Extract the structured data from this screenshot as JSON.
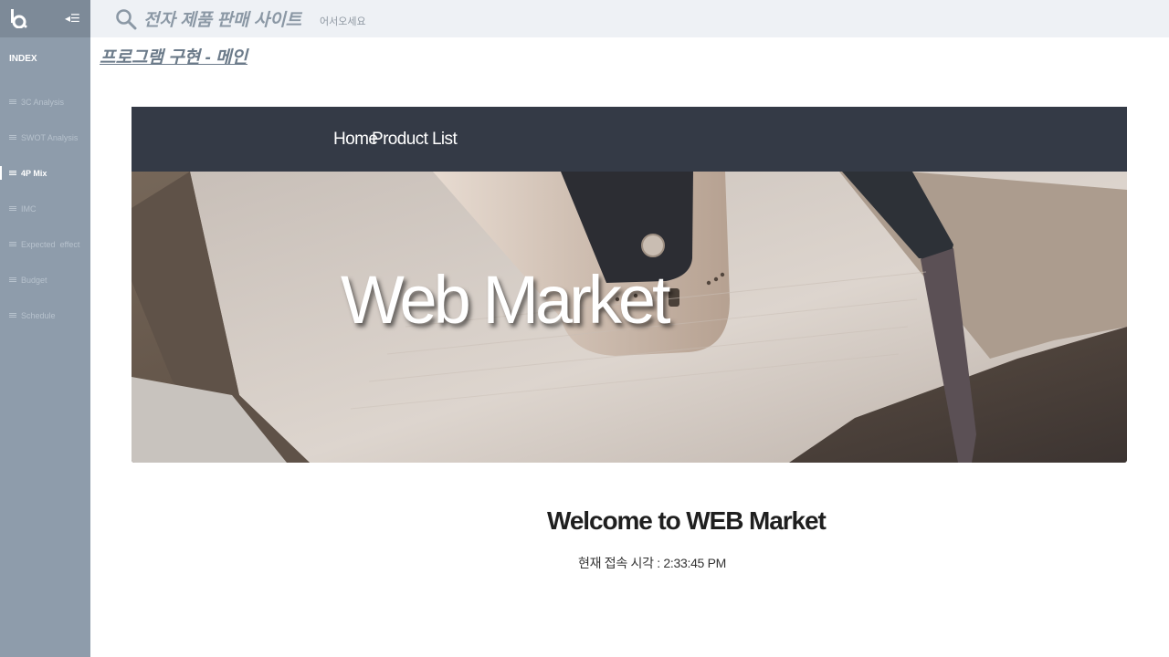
{
  "sidebar": {
    "index_label": "INDEX",
    "items": [
      {
        "label": "3C Analysis",
        "active": false
      },
      {
        "label": "SWOT Analysis",
        "active": false
      },
      {
        "label": "4P Mix",
        "active": true
      },
      {
        "label": "IMC",
        "active": false
      },
      {
        "label": "Expected  effect",
        "active": false
      },
      {
        "label": "Budget",
        "active": false
      },
      {
        "label": "Schedule",
        "active": false
      }
    ]
  },
  "topbar": {
    "title": "전자 제품 판매 사이트",
    "subtitle": "어서오세요"
  },
  "page": {
    "title": "프로그램 구현 - 메인"
  },
  "web_market": {
    "nav": {
      "home": "Home",
      "product_list": "Product List"
    },
    "hero_title": "Web Market",
    "welcome_heading": "Welcome to WEB Market",
    "current_time": "현재 접속 시각 : 2:33:45 PM"
  },
  "colors": {
    "sidebar": "#8e9cab",
    "topbar": "#eef1f5",
    "market_nav": "#343a46"
  }
}
